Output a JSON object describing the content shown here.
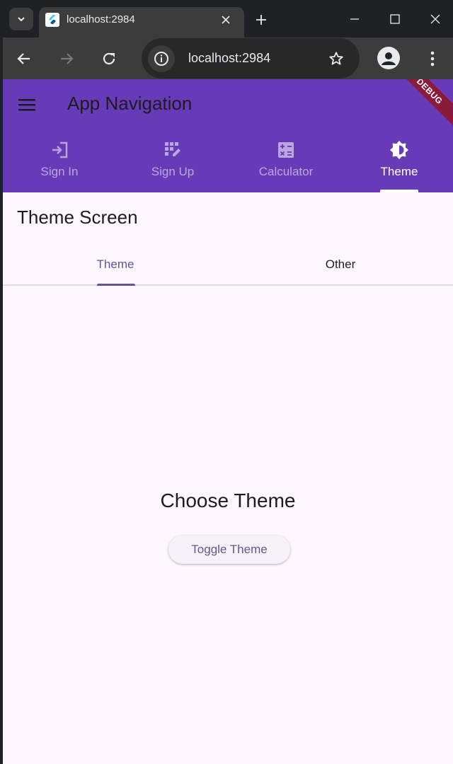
{
  "browser": {
    "tab_title": "localhost:2984",
    "url": "localhost:2984"
  },
  "app": {
    "title": "App Navigation",
    "debug_label": "DEBUG",
    "nav_tabs": [
      {
        "label": "Sign In",
        "icon": "login-icon"
      },
      {
        "label": "Sign Up",
        "icon": "app-registration-icon"
      },
      {
        "label": "Calculator",
        "icon": "calculate-icon"
      },
      {
        "label": "Theme",
        "icon": "brightness-icon"
      }
    ],
    "active_nav_tab": "Theme"
  },
  "screen": {
    "title": "Theme Screen",
    "tabs": [
      {
        "label": "Theme"
      },
      {
        "label": "Other"
      }
    ],
    "active_tab": "Theme",
    "heading": "Choose Theme",
    "toggle_button_label": "Toggle Theme"
  },
  "colors": {
    "app_bar": "#673ab7",
    "background": "#fef7ff",
    "accent": "#65558f",
    "debug_banner": "#8b1b3a"
  }
}
